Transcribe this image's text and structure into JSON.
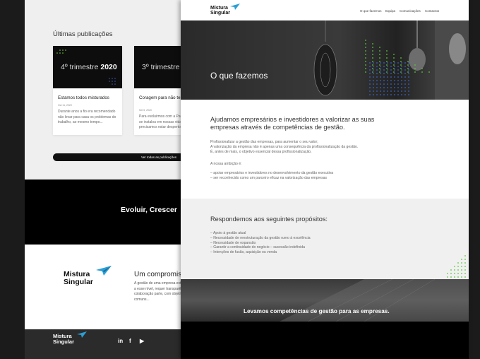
{
  "back_page": {
    "section_title": "Últimas publicações",
    "cards": [
      {
        "image_text_prefix": "4º trimestre",
        "image_text_year": "2020",
        "title": "Estamos todos misturados",
        "date": "Oct 11, 2020",
        "excerpt": "Durante anos a fio era recomendado não levar para casa os problemas do trabalho, ao mesmo tempo..."
      },
      {
        "image_text_prefix": "3º trimestre",
        "image_text_year": "2",
        "title": "Coragem para não ter medo!",
        "date": "Set 5, 2020",
        "excerpt": "Para evoluirmos com a Pandemia que se instalou em nossas vidas só precisamos estar despertos..."
      }
    ],
    "all_button_label": "Ver todas as publicações",
    "slogan": "Evoluir, Crescer",
    "logo": {
      "line1": "Mistura",
      "line2": "Singular"
    },
    "commitment_title": "Um compromisso",
    "commitment_text": "A gestão de uma empresa externa a esse nível, requer transparência e colaboração parte, com objetivos comuns...",
    "footer_logo": {
      "line1": "Mistura",
      "line2": "Singular"
    },
    "social": [
      "in",
      "f",
      "▶"
    ]
  },
  "front_page": {
    "logo": {
      "line1": "Mistura",
      "line2": "Singular"
    },
    "nav": [
      "O que fazemos",
      "Equipa",
      "Comunicações",
      "Contactos"
    ],
    "hero_title": "O que fazemos",
    "intro": "Ajudamos empresários e investidores a valorizar as suas empresas através de competências de gestão.",
    "intro_paragraph": "Profissionalizar a gestão das empresas, para aumentar o seu valor;\nA valorização da empresa não é apenas uma consequência da profissionalização da gestão.\nÉ, antes de mais, o objetivo essencial dessa profissionalização.",
    "ambition_label": "A nossa ambição é:",
    "ambition_items": "– apoiar empresários e investidores no desenvolvimento da gestão executiva\n– ser reconhecido como um parceiro eficaz na valorização das empresas",
    "purposes_title": "Respondemos aos seguintes propósitos:",
    "purposes": "– Apoio à gestão atual\n– Necessidade de reestruturação da gestão rumo à excelência\n– Necessidade de expansão\n– Garantir a continuidade do negócio – sucessão indefinida\n– Intenções de fusão, aquisição ou venda",
    "banner_text": "Levamos competências de gestão para as empresas."
  },
  "colors": {
    "accent": "#2a9fd6",
    "dots": "#5fc63e",
    "dark": "#0d0d0d"
  }
}
